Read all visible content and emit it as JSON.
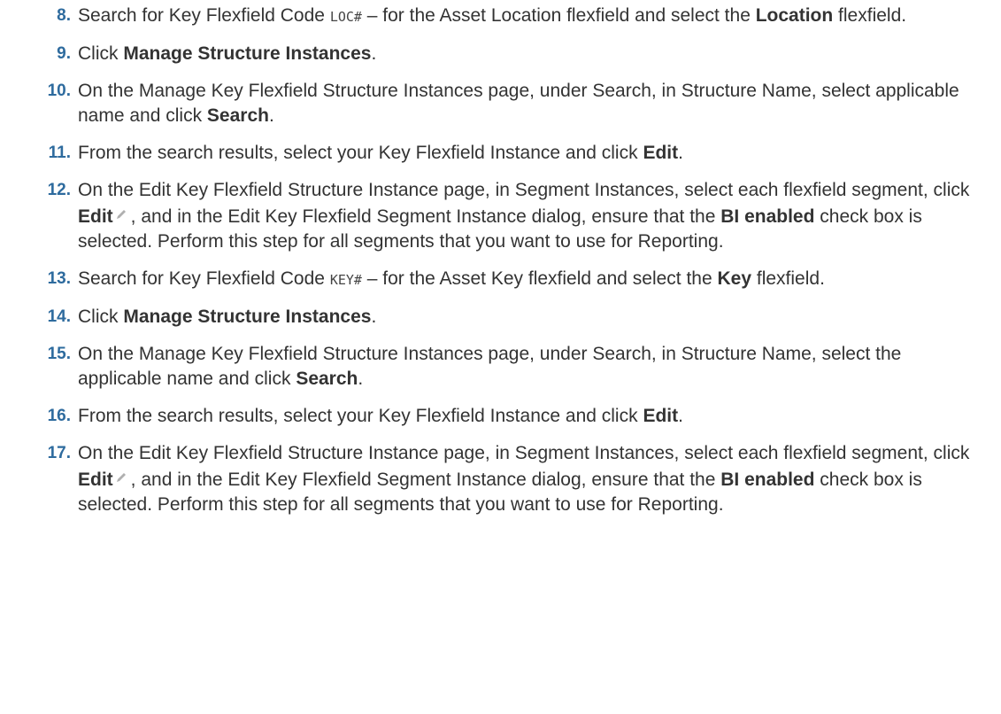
{
  "steps": [
    {
      "num": "8.",
      "parts": [
        {
          "t": "text",
          "v": "Search for Key Flexfield Code "
        },
        {
          "t": "code",
          "v": "LOC#"
        },
        {
          "t": "text",
          "v": " – for the Asset Location flexfield and select the "
        },
        {
          "t": "bold",
          "v": "Location"
        },
        {
          "t": "text",
          "v": " flexfield."
        }
      ]
    },
    {
      "num": "9.",
      "parts": [
        {
          "t": "text",
          "v": "Click "
        },
        {
          "t": "bold",
          "v": "Manage Structure Instances"
        },
        {
          "t": "text",
          "v": "."
        }
      ]
    },
    {
      "num": "10.",
      "parts": [
        {
          "t": "text",
          "v": "On the Manage Key Flexfield Structure Instances page, under Search, in Structure Name, select applicable name and click "
        },
        {
          "t": "bold",
          "v": "Search"
        },
        {
          "t": "text",
          "v": "."
        }
      ]
    },
    {
      "num": "11.",
      "parts": [
        {
          "t": "text",
          "v": "From the search results, select your Key Flexfield Instance and click "
        },
        {
          "t": "bold",
          "v": "Edit"
        },
        {
          "t": "text",
          "v": "."
        }
      ]
    },
    {
      "num": "12.",
      "parts": [
        {
          "t": "text",
          "v": "On the Edit Key Flexfield Structure Instance page, in Segment Instances, select each flexfield segment, click "
        },
        {
          "t": "bold",
          "v": "Edit"
        },
        {
          "t": "icon",
          "v": "pencil-icon"
        },
        {
          "t": "text",
          "v": ", and in the Edit Key Flexfield Segment Instance dialog, ensure that the "
        },
        {
          "t": "bold",
          "v": "BI enabled"
        },
        {
          "t": "text",
          "v": " check box is selected. Perform this step for all segments that you want to use for Reporting."
        }
      ]
    },
    {
      "num": "13.",
      "parts": [
        {
          "t": "text",
          "v": "Search for Key Flexfield Code "
        },
        {
          "t": "code",
          "v": "KEY#"
        },
        {
          "t": "text",
          "v": " – for the Asset Key flexfield and select the "
        },
        {
          "t": "bold",
          "v": "Key"
        },
        {
          "t": "text",
          "v": " flexfield."
        }
      ]
    },
    {
      "num": "14.",
      "parts": [
        {
          "t": "text",
          "v": "Click "
        },
        {
          "t": "bold",
          "v": "Manage Structure Instances"
        },
        {
          "t": "text",
          "v": "."
        }
      ]
    },
    {
      "num": "15.",
      "parts": [
        {
          "t": "text",
          "v": "On the Manage Key Flexfield Structure Instances page, under Search, in Structure Name, select the applicable name and click "
        },
        {
          "t": "bold",
          "v": "Search"
        },
        {
          "t": "text",
          "v": "."
        }
      ]
    },
    {
      "num": "16.",
      "parts": [
        {
          "t": "text",
          "v": "From the search results, select your Key Flexfield Instance and click "
        },
        {
          "t": "bold",
          "v": "Edit"
        },
        {
          "t": "text",
          "v": "."
        }
      ]
    },
    {
      "num": "17.",
      "parts": [
        {
          "t": "text",
          "v": "On the Edit Key Flexfield Structure Instance page, in Segment Instances, select each flexfield segment, click "
        },
        {
          "t": "bold",
          "v": "Edit"
        },
        {
          "t": "icon",
          "v": "pencil-icon"
        },
        {
          "t": "text",
          "v": ", and in the Edit Key Flexfield Segment Instance dialog, ensure that the "
        },
        {
          "t": "bold",
          "v": "BI enabled"
        },
        {
          "t": "text",
          "v": " check box is selected. Perform this step for all segments that you want to use for Reporting."
        }
      ]
    }
  ],
  "colors": {
    "number": "#2e6b9e",
    "text": "#333333",
    "icon": "#b0b0b0"
  }
}
